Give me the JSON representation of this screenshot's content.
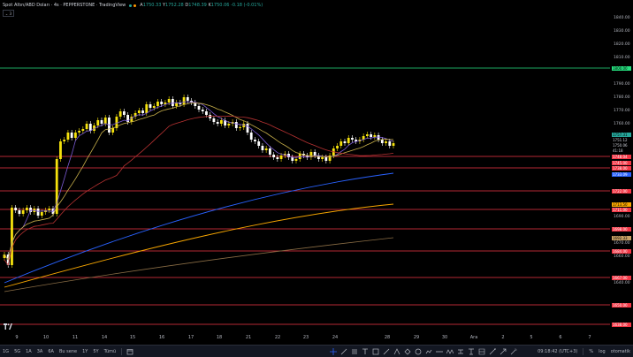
{
  "header": {
    "title": "Spot Altın/ABD Doları · 4s · PEPPERSTONE · TradingView",
    "ohlc": {
      "o_label": "A",
      "o": "1750.33",
      "h_label": "Y",
      "h": "1752.28",
      "l_label": "D",
      "l": "1748.39",
      "c_label": "K",
      "c": "1750.06",
      "change": "-0.18 (-0.01%)"
    },
    "collapse_label": "3"
  },
  "price_axis": {
    "ticks": [
      "1840.00",
      "1830.00",
      "1820.00",
      "1810.00",
      "1790.00",
      "1780.00",
      "1770.00",
      "1760.00",
      "1690.00",
      "1680.00",
      "1670.00",
      "1660.00",
      "1640.00"
    ],
    "levels": [
      {
        "label": "1800.00",
        "color": "#26e07f",
        "text": "#000"
      },
      {
        "label": "1757.31",
        "color": "#26a69a",
        "text": "#000"
      },
      {
        "label": "1751.12",
        "color": "#000",
        "text": "#d1d4dc"
      },
      {
        "label": "1750.06",
        "color": "#000",
        "text": "#d1d4dc"
      },
      {
        "label": "41:18",
        "color": "#000",
        "text": "#d1d4dc"
      },
      {
        "label": "1748.04",
        "color": "#f23645",
        "text": "#fff"
      },
      {
        "label": "1745.00",
        "color": "#f23645",
        "text": "#fff"
      },
      {
        "label": "1738.00",
        "color": "#f23645",
        "text": "#fff"
      },
      {
        "label": "1733.09",
        "color": "#2962ff",
        "text": "#fff"
      },
      {
        "label": "1722.00",
        "color": "#f23645",
        "text": "#fff"
      },
      {
        "label": "1713.50",
        "color": "#f7a600",
        "text": "#000"
      },
      {
        "label": "1711.00",
        "color": "#f23645",
        "text": "#fff"
      },
      {
        "label": "1698.00",
        "color": "#f23645",
        "text": "#fff"
      },
      {
        "label": "1692.33",
        "color": "#c8a165",
        "text": "#000"
      },
      {
        "label": "1684.00",
        "color": "#f23645",
        "text": "#fff"
      },
      {
        "label": "1667.00",
        "color": "#f23645",
        "text": "#fff"
      },
      {
        "label": "1650.00",
        "color": "#f23645",
        "text": "#fff"
      },
      {
        "label": "1638.00",
        "color": "#f23645",
        "text": "#fff"
      }
    ]
  },
  "time_axis": {
    "ticks": [
      "9",
      "10",
      "11",
      "14",
      "15",
      "16",
      "17",
      "18",
      "21",
      "22",
      "23",
      "24",
      "28",
      "29",
      "30",
      "Ara",
      "2",
      "5",
      "6",
      "7"
    ]
  },
  "toolbar": {
    "ranges": [
      "1G",
      "5G",
      "1A",
      "3A",
      "6A",
      "Bu sene",
      "1Y",
      "5Y",
      "Tümü"
    ],
    "time": "09:18:42 (UTC+3)",
    "percent": "%",
    "log": "log",
    "auto": "otomatik"
  },
  "colors": {
    "bull": "#f5e20d",
    "bear": "#ffffff",
    "resistance": "#f23645",
    "support_green": "#26e07f"
  }
}
